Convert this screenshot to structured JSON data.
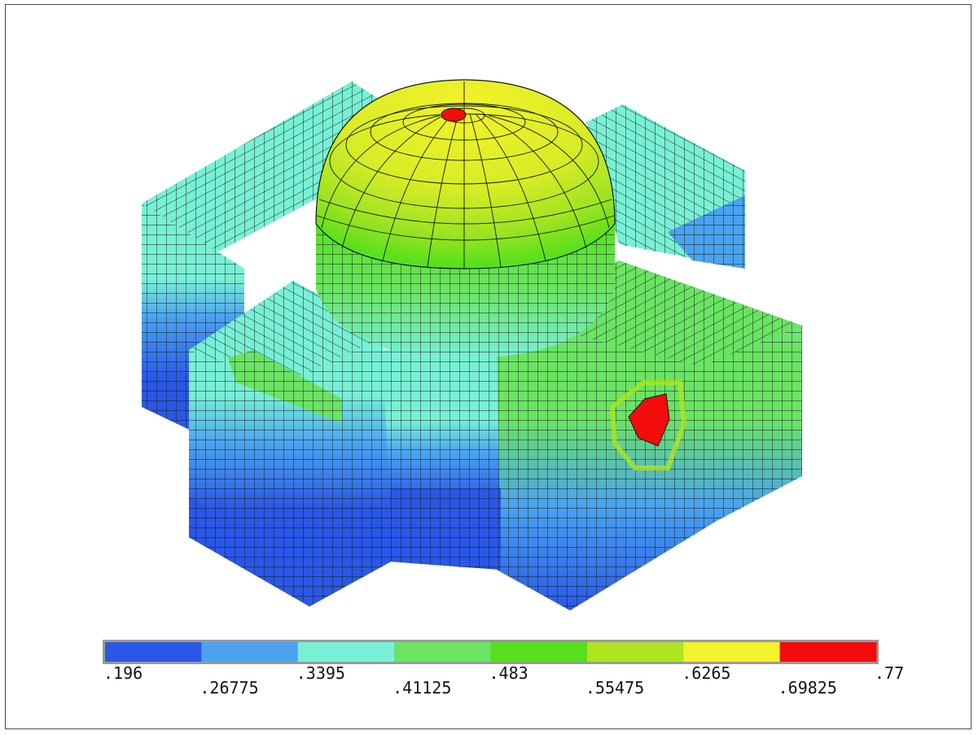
{
  "colors": {
    "background": "#ffffff",
    "border": "#4a4a4a",
    "mesh_line": "#0b1a12",
    "band_1": "#2b57e6",
    "band_2": "#4ba3ef",
    "band_3": "#79f0d6",
    "band_4": "#6be363",
    "band_5": "#56e01b",
    "band_6": "#aee520",
    "band_7": "#f4f22a",
    "band_8": "#f20c0c"
  },
  "legend": {
    "type": "contour-colorbar",
    "bands": [
      {
        "from": ".196",
        "to": ".26775",
        "color": "#2b57e6"
      },
      {
        "from": ".26775",
        "to": ".3395",
        "color": "#4ba3ef"
      },
      {
        "from": ".3395",
        "to": ".41125",
        "color": "#79f0d6"
      },
      {
        "from": ".41125",
        "to": ".483",
        "color": "#6be363"
      },
      {
        "from": ".483",
        "to": ".55475",
        "color": "#56e01b"
      },
      {
        "from": ".55475",
        "to": ".6265",
        "color": "#aee520"
      },
      {
        "from": ".6265",
        "to": ".69825",
        "color": "#f4f22a"
      },
      {
        "from": ".69825",
        "to": ".77",
        "color": "#f20c0c"
      }
    ],
    "tick_labels": [
      ".196",
      ".26775",
      ".3395",
      ".41125",
      ".483",
      ".55475",
      ".6265",
      ".69825",
      ".77"
    ]
  }
}
